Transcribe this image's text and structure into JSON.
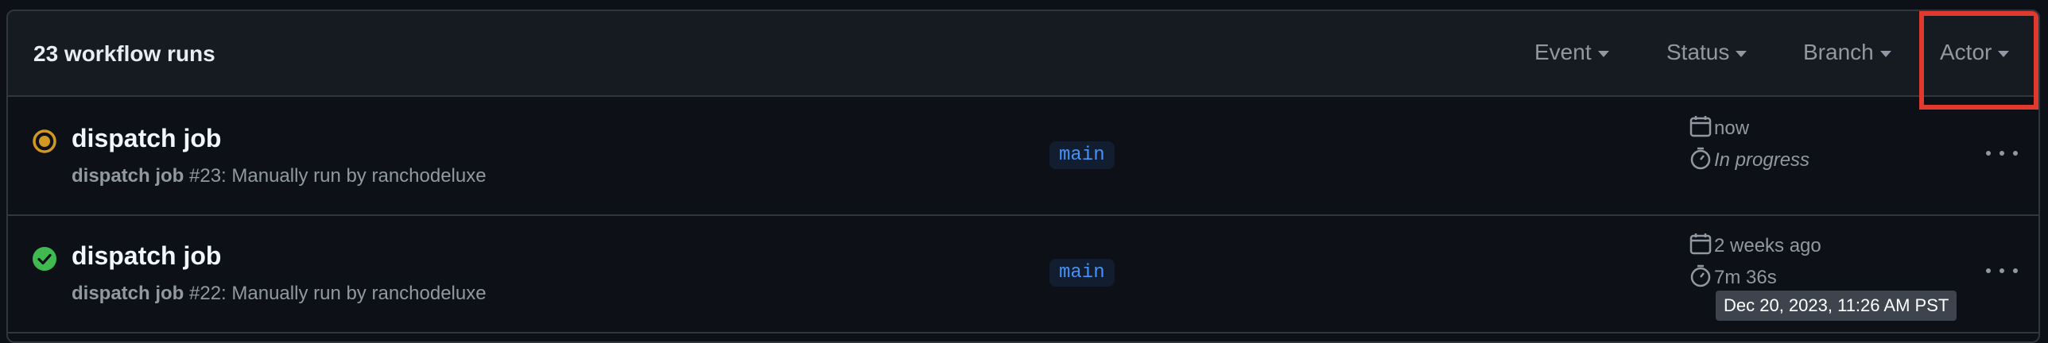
{
  "header": {
    "run_count": "23 workflow runs",
    "filters": {
      "event": "Event",
      "status": "Status",
      "branch": "Branch",
      "actor": "Actor"
    }
  },
  "runs": [
    {
      "status": "in-progress",
      "status_icon": "in-progress-icon",
      "title": "dispatch job",
      "subtitle_workflow": "dispatch job",
      "subtitle_rest": " #23: Manually run by ranchodeluxe",
      "branch": "main",
      "time": "now",
      "duration": "In progress"
    },
    {
      "status": "success",
      "status_icon": "check-circle-icon",
      "title": "dispatch job",
      "subtitle_workflow": "dispatch job",
      "subtitle_rest": " #22: Manually run by ranchodeluxe",
      "branch": "main",
      "time": "2 weeks ago",
      "duration": "7m 36s"
    }
  ],
  "tooltip": "Dec 20, 2023, 11:26 AM PST",
  "colors": {
    "background": "#0d1117",
    "header_bg": "#161b22",
    "border": "#30363d",
    "in_progress": "#d29922",
    "success": "#3fb950",
    "branch_text": "#4493f8",
    "highlight": "#e03a2f"
  }
}
